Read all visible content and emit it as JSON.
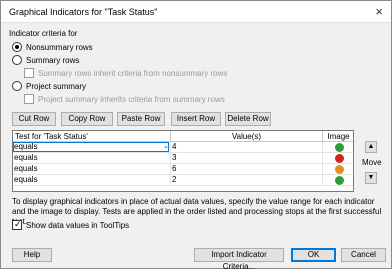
{
  "window": {
    "title": "Graphical Indicators for \"Task Status\"",
    "close_glyph": "×"
  },
  "criteria": {
    "label": "Indicator criteria for",
    "options": [
      {
        "label": "Nonsummary rows",
        "selected": true
      },
      {
        "label": "Summary rows",
        "selected": false
      },
      {
        "label": "Project summary",
        "selected": false
      }
    ],
    "summary_inherit": "Summary rows inherit criteria from nonsummary rows",
    "project_inherit": "Project summary inherits criteria from summary rows"
  },
  "toolbar": {
    "cut": "Cut Row",
    "copy": "Copy Row",
    "paste": "Paste Row",
    "insert": "Insert Row",
    "delete": "Delete Row"
  },
  "grid": {
    "headers": [
      "Test for 'Task Status'",
      "Value(s)",
      "Image"
    ],
    "rows": [
      {
        "test": "equals",
        "value": "4",
        "color": "#2e9e3a"
      },
      {
        "test": "equals",
        "value": "3",
        "color": "#d3261f"
      },
      {
        "test": "equals",
        "value": "6",
        "color": "#e0901c"
      },
      {
        "test": "equals",
        "value": "2",
        "color": "#2e9e3a"
      }
    ]
  },
  "move": {
    "label": "Move",
    "up": "▲",
    "down": "▼"
  },
  "info_text": "To display graphical indicators in place of actual data values, specify the value range for each indicator and the image to display. Tests are applied in the order listed and processing stops at the first successful test.",
  "tooltip_option": {
    "label": "Show data values in ToolTips",
    "checked": true
  },
  "footer": {
    "help": "Help",
    "import": "Import Indicator Criteria...",
    "ok": "OK",
    "cancel": "Cancel"
  }
}
